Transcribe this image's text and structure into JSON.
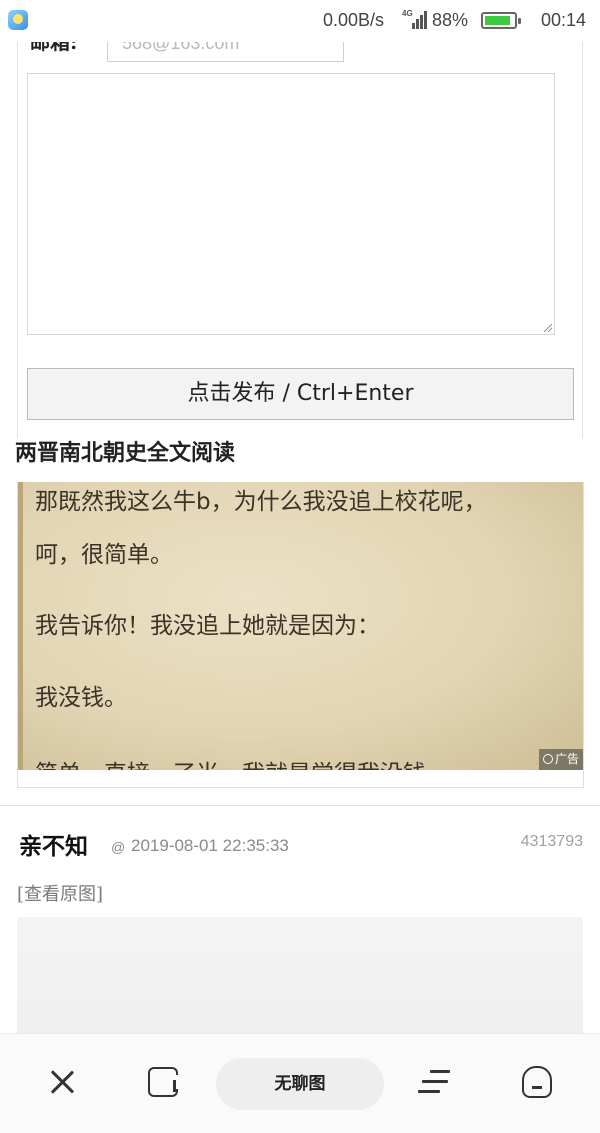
{
  "status_bar": {
    "net_speed": "0.00B/s",
    "network_type": "4G",
    "battery_percent": "88%",
    "battery_level": 0.88,
    "time": "00:14",
    "colors": {
      "battery_fill": "#3ec93e"
    }
  },
  "comment_form": {
    "email_label": "邮箱:",
    "email_placeholder": "568@163.com",
    "comment_value": "",
    "publish_label": "点击发布  /  Ctrl+Enter"
  },
  "ad": {
    "title": "两晋南北朝史全文阅读",
    "lines": [
      "那既然我这么牛b，为什么我没追上校花呢，",
      "呵，很简单。",
      "我告诉你！我没追上她就是因为：",
      "我没钱。",
      "简单，直接，了当，我就是觉得我没钱"
    ],
    "badge": "广告"
  },
  "comment": {
    "author": "亲不知",
    "at_symbol": "@",
    "timestamp": "2019-08-01  22:35:33",
    "id": "4313793",
    "view_original": "[查看原图]"
  },
  "toolbar": {
    "close_icon": "close-icon",
    "tabs_icon": "tabs-icon",
    "page_title": "无聊图",
    "menu_icon": "menu-icon",
    "home_icon": "home-icon"
  }
}
